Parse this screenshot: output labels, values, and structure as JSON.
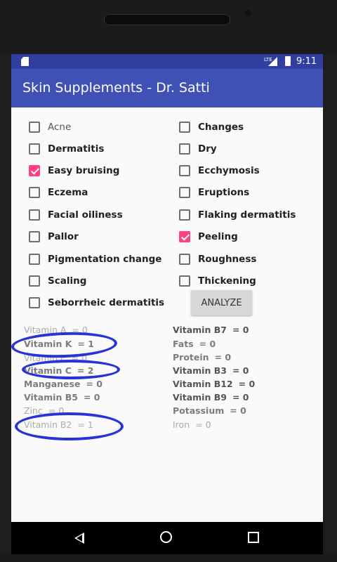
{
  "status_bar": {
    "network": "LTE",
    "time": "9:11"
  },
  "app_bar": {
    "title": "Skin Supplements - Dr. Satti"
  },
  "symptoms_left": [
    {
      "label": "Acne",
      "checked": false
    },
    {
      "label": "Dermatitis",
      "checked": false
    },
    {
      "label": "Easy bruising",
      "checked": true
    },
    {
      "label": "Eczema",
      "checked": false
    },
    {
      "label": "Facial oiliness",
      "checked": false
    },
    {
      "label": "Pallor",
      "checked": false
    },
    {
      "label": "Pigmentation change",
      "checked": false
    },
    {
      "label": "Scaling",
      "checked": false
    },
    {
      "label": "Seborrheic dermatitis",
      "checked": false
    }
  ],
  "symptoms_right": [
    {
      "label": "Changes",
      "checked": false
    },
    {
      "label": "Dry",
      "checked": false
    },
    {
      "label": "Ecchymosis",
      "checked": false
    },
    {
      "label": "Eruptions",
      "checked": false
    },
    {
      "label": "Flaking dermatitis",
      "checked": false
    },
    {
      "label": "Peeling",
      "checked": true
    },
    {
      "label": "Roughness",
      "checked": false
    },
    {
      "label": "Thickening",
      "checked": false
    }
  ],
  "analyze_button": {
    "label": "ANALYZE"
  },
  "results_left": [
    {
      "label": "Vitamin A",
      "value": "= 0"
    },
    {
      "label": "Vitamin K",
      "value": "= 1"
    },
    {
      "label": "Vitamin E",
      "value": "= 0"
    },
    {
      "label": "Vitamin C",
      "value": "= 2"
    },
    {
      "label": "Manganese",
      "value": "= 0"
    },
    {
      "label": "Vitamin B5",
      "value": "= 0"
    },
    {
      "label": "Zinc",
      "value": "= 0"
    },
    {
      "label": "Vitamin B2",
      "value": "= 1"
    }
  ],
  "results_right": [
    {
      "label": "Vitamin B7",
      "value": "= 0"
    },
    {
      "label": "Fats",
      "value": "= 0"
    },
    {
      "label": "Protein",
      "value": "= 0"
    },
    {
      "label": "Vitamin B3",
      "value": "= 0"
    },
    {
      "label": "Vitamin B12",
      "value": "= 0"
    },
    {
      "label": "Vitamin B9",
      "value": "= 0"
    },
    {
      "label": "Potassium",
      "value": "= 0"
    },
    {
      "label": "Iron",
      "value": "= 0"
    }
  ],
  "annotation": {
    "color": "#2832d8"
  }
}
